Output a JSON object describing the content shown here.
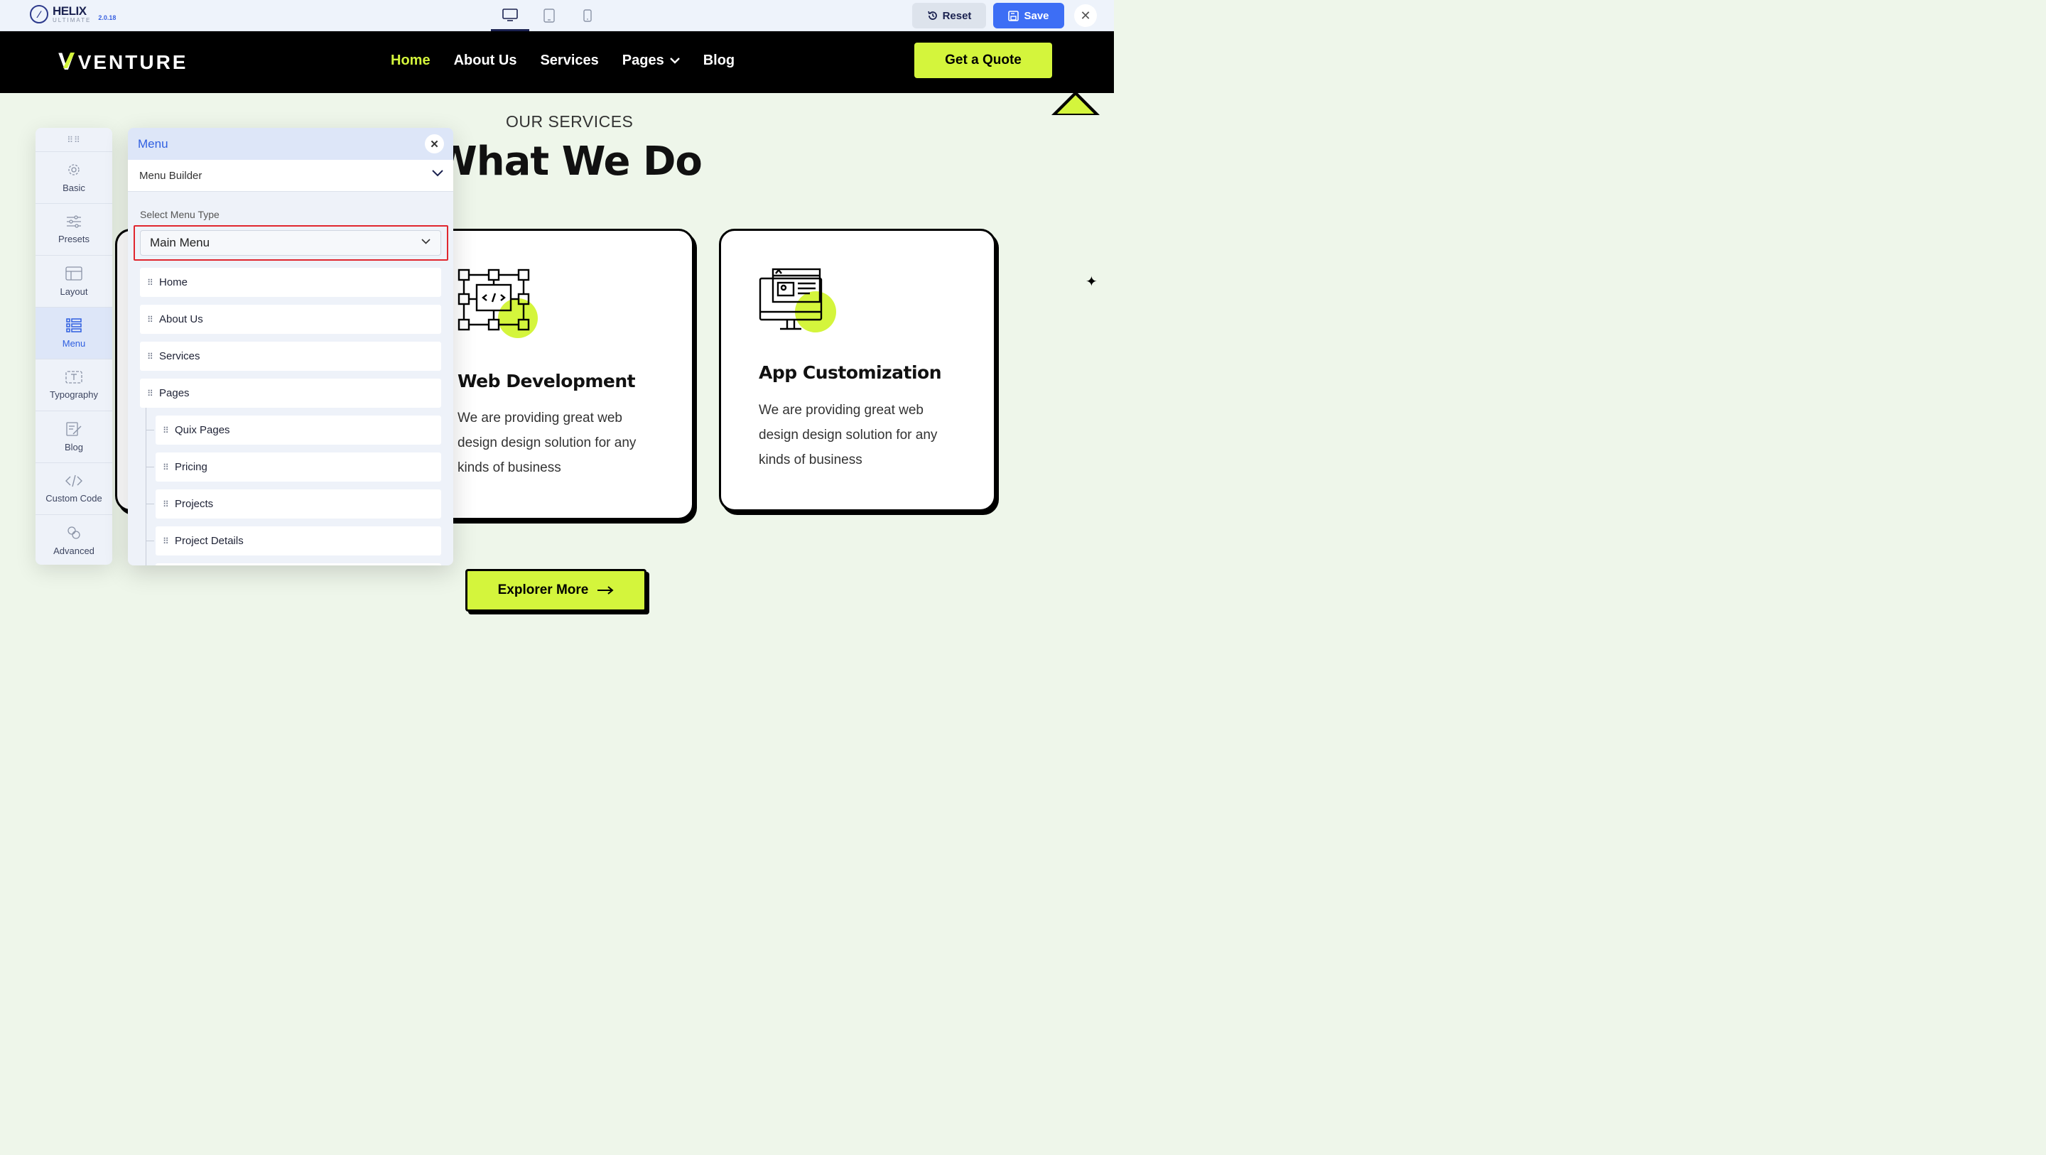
{
  "helix": {
    "logo_name": "HELIX",
    "logo_sub": "ULTIMATE",
    "version": "2.0.18",
    "devices": [
      "desktop-icon",
      "tablet-icon",
      "mobile-icon"
    ],
    "reset_label": "Reset",
    "save_label": "Save"
  },
  "site": {
    "logo": "VENTURE",
    "nav": [
      {
        "label": "Home",
        "active": true
      },
      {
        "label": "About Us"
      },
      {
        "label": "Services"
      },
      {
        "label": "Pages",
        "dropdown": true
      },
      {
        "label": "Blog"
      }
    ],
    "cta": "Get a Quote"
  },
  "section": {
    "subtitle": "OUR SERVICES",
    "title": "What We Do",
    "cards": [
      {
        "title": "Web Development",
        "text": [
          "We are providing great web",
          "design design solution for any",
          "kinds of business"
        ]
      },
      {
        "title": "App Customization",
        "text": [
          "We are providing great web",
          "design design solution for any",
          "kinds of business"
        ]
      }
    ],
    "button": "Explorer More"
  },
  "rail": {
    "items": [
      {
        "label": "Basic",
        "icon": "gear-icon"
      },
      {
        "label": "Presets",
        "icon": "sliders-icon"
      },
      {
        "label": "Layout",
        "icon": "layout-icon"
      },
      {
        "label": "Menu",
        "icon": "list-icon",
        "active": true
      },
      {
        "label": "Typography",
        "icon": "text-icon"
      },
      {
        "label": "Blog",
        "icon": "edit-icon"
      },
      {
        "label": "Custom Code",
        "icon": "code-icon"
      },
      {
        "label": "Advanced",
        "icon": "advanced-icon"
      }
    ]
  },
  "panel": {
    "title": "Menu",
    "section": "Menu Builder",
    "field_label": "Select Menu Type",
    "selected_menu": "Main Menu",
    "items": [
      {
        "label": "Home",
        "level": 0
      },
      {
        "label": "About Us",
        "level": 0
      },
      {
        "label": "Services",
        "level": 0
      },
      {
        "label": "Pages",
        "level": 0
      },
      {
        "label": "Quix Pages",
        "level": 1
      },
      {
        "label": "Pricing",
        "level": 1
      },
      {
        "label": "Projects",
        "level": 1
      },
      {
        "label": "Project Details",
        "level": 1
      }
    ]
  },
  "colors": {
    "accent_lime": "#d4f53c",
    "helix_blue": "#3d6ef5",
    "highlight_red": "#e0262e"
  }
}
